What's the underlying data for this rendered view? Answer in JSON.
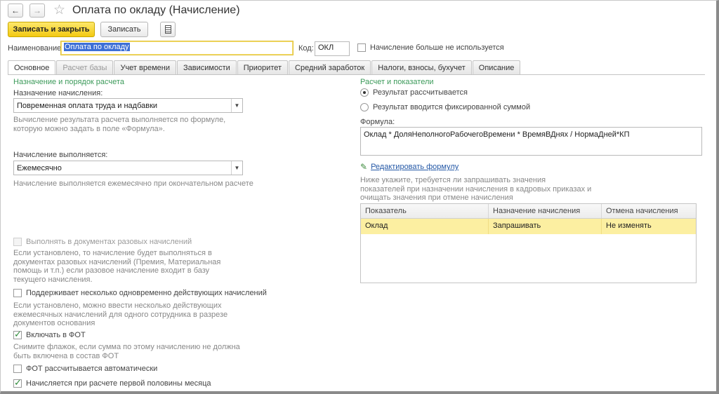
{
  "window": {
    "title": "Оплата по окладу (Начисление)"
  },
  "toolbar": {
    "save_close": "Записать и закрыть",
    "save": "Записать"
  },
  "header": {
    "name_label": "Наименование:",
    "name_value": "Оплата по окладу",
    "code_label": "Код:",
    "code_value": "ОКЛ",
    "not_used_label": "Начисление больше не используется"
  },
  "tabs": [
    {
      "label": "Основное"
    },
    {
      "label": "Расчет базы"
    },
    {
      "label": "Учет времени"
    },
    {
      "label": "Зависимости"
    },
    {
      "label": "Приоритет"
    },
    {
      "label": "Средний заработок"
    },
    {
      "label": "Налоги, взносы, бухучет"
    },
    {
      "label": "Описание"
    }
  ],
  "left": {
    "section_title": "Назначение и порядок расчета",
    "purpose_label": "Назначение начисления:",
    "purpose_value": "Повременная оплата труда и надбавки",
    "purpose_hint_1": "Вычисление результата расчета выполняется по формуле,",
    "purpose_hint_2": "которую можно задать в поле «Формула».",
    "period_label": "Начисление выполняется:",
    "period_value": "Ежемесячно",
    "period_hint": "Начисление выполняется ежемесячно при окончательном расчете",
    "one_time_label": "Выполнять в документах разовых начислений",
    "one_time_hint": [
      "Если установлено, то начисление будет выполняться в",
      "документах разовых начислений (Премия, Материальная",
      "помощь и т.п.) если разовое начисление входит в базу",
      "текущего начисления."
    ],
    "multi_label": "Поддерживает несколько одновременно действующих начислений",
    "multi_hint": [
      "Если установлено, можно ввести несколько действующих",
      "ежемесячных начислений для одного сотрудника в разрезе",
      "документов основания"
    ],
    "fot_label": "Включать в ФОТ",
    "fot_hint": [
      "Снимите флажок, если сумма по этому начислению не должна",
      "быть включена в состав ФОТ"
    ],
    "fot_auto_label": "ФОТ рассчитывается автоматически",
    "first_half_label": "Начисляется при расчете первой половины месяца"
  },
  "right": {
    "section_title": "Расчет и показатели",
    "radio_calc": "Результат рассчитывается",
    "radio_fixed": "Результат вводится фиксированной суммой",
    "formula_label": "Формула:",
    "formula_value": "Оклад * ДоляНеполногоРабочегоВремени * ВремяВДнях / НормаДней*КП",
    "edit_formula": "Редактировать формулу",
    "note": [
      "Ниже укажите, требуется ли запрашивать значения",
      "показателей при назначении начисления в кадровых приказах и",
      "очищать значения при отмене начисления"
    ],
    "table": {
      "headers": [
        "Показатель",
        "Назначение начисления",
        "Отмена начисления"
      ],
      "rows": [
        [
          "Оклад",
          "Запрашивать",
          "Не изменять"
        ]
      ]
    }
  }
}
